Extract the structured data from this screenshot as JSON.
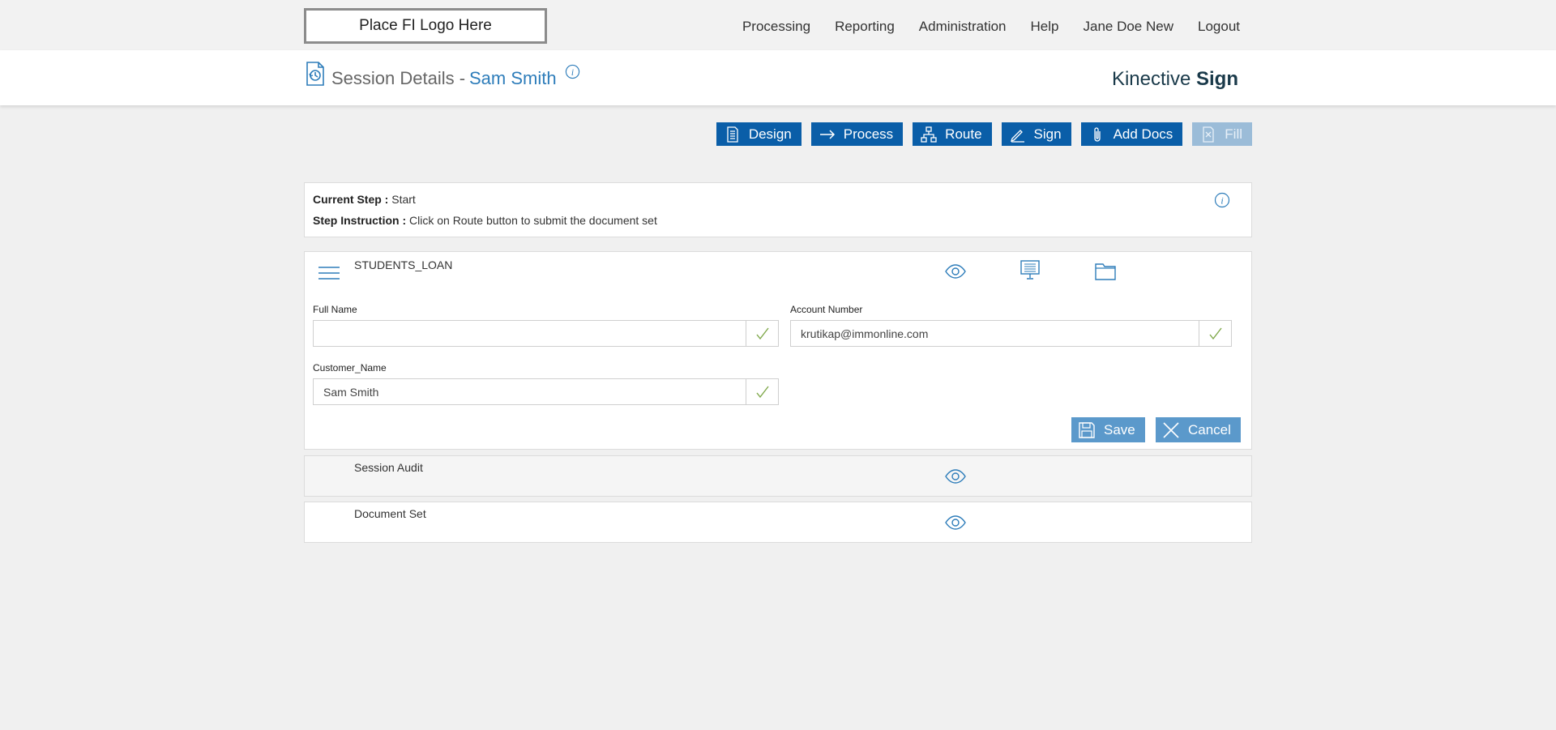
{
  "topbar": {
    "logo_text": "Place FI Logo Here",
    "nav": [
      {
        "label": "Processing"
      },
      {
        "label": "Reporting"
      },
      {
        "label": "Administration"
      },
      {
        "label": "Help"
      },
      {
        "label": "Jane Doe New"
      },
      {
        "label": "Logout"
      }
    ]
  },
  "header": {
    "title": "Session Details -",
    "customer": "Sam Smith",
    "brand_light": "Kinective",
    "brand_bold": "Sign"
  },
  "toolbar": {
    "buttons": [
      {
        "label": "Design",
        "icon": "design-icon",
        "enabled": true
      },
      {
        "label": "Process",
        "icon": "arrow-right-icon",
        "enabled": true
      },
      {
        "label": "Route",
        "icon": "route-icon",
        "enabled": true
      },
      {
        "label": "Sign",
        "icon": "pen-icon",
        "enabled": true
      },
      {
        "label": "Add Docs",
        "icon": "paperclip-icon",
        "enabled": true
      },
      {
        "label": "Fill",
        "icon": "fill-icon",
        "enabled": false
      }
    ]
  },
  "step_info": {
    "current_step_label": "Current Step :",
    "current_step_value": "Start",
    "instruction_label": "Step Instruction :",
    "instruction_value": "Click on Route button to submit the document set"
  },
  "document": {
    "name": "STUDENTS_LOAN",
    "fields": {
      "full_name": {
        "label": "Full Name",
        "value": ""
      },
      "account_number": {
        "label": "Account Number",
        "value": "krutikap@immonline.com"
      },
      "customer_name": {
        "label": "Customer_Name",
        "value": "Sam Smith"
      }
    },
    "save_label": "Save",
    "cancel_label": "Cancel"
  },
  "sections": {
    "audit": "Session Audit",
    "docset": "Document Set"
  },
  "colors": {
    "primary": "#0a5ea8",
    "primary_disabled": "#9bbcd8",
    "secondary": "#5b99cb",
    "link": "#2e7dba",
    "check": "#7fa84a"
  }
}
